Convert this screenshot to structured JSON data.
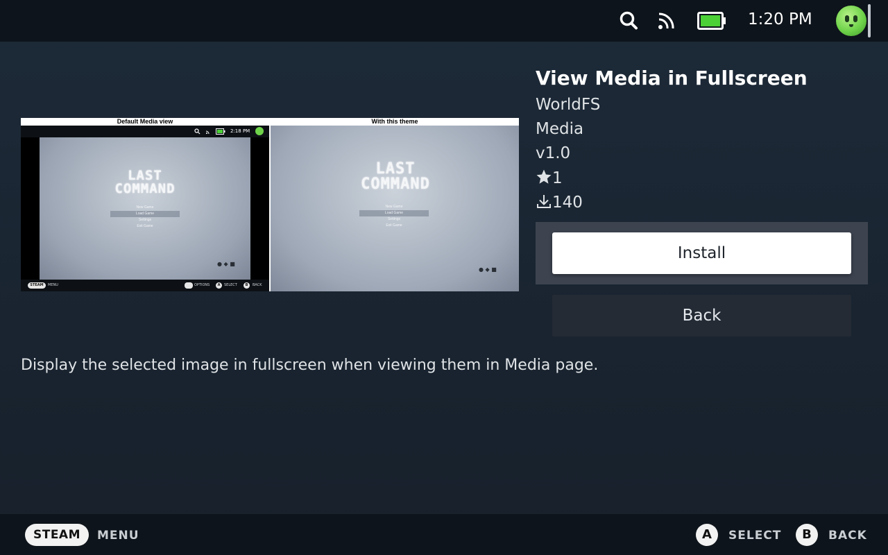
{
  "status_bar": {
    "time": "1:20 PM",
    "icons": [
      "search-icon",
      "rss-icon",
      "battery-icon"
    ],
    "battery_color": "#4cd137"
  },
  "preview": {
    "left_caption": "Default Media view",
    "right_caption": "With this theme",
    "mini_time": "2:18 PM",
    "game_logo_line1": "LAST",
    "game_logo_line2": "COMMAND",
    "game_menu": [
      "New Game",
      "Load Game",
      "Settings",
      "Exit Game"
    ],
    "mini_steam": "STEAM",
    "mini_menu": "MENU",
    "mini_options": "OPTIONS",
    "mini_select": "SELECT",
    "mini_back": "BACK",
    "mini_a": "A",
    "mini_b": "B"
  },
  "theme": {
    "title": "View Media in Fullscreen",
    "author": "WorldFS",
    "category": "Media",
    "version": "v1.0",
    "stars": "1",
    "downloads": "140",
    "description": "Display the selected image in fullscreen when viewing them in Media page."
  },
  "buttons": {
    "install": "Install",
    "back": "Back"
  },
  "footer": {
    "steam": "STEAM",
    "menu": "MENU",
    "a": "A",
    "select": "SELECT",
    "b": "B",
    "back": "BACK"
  }
}
